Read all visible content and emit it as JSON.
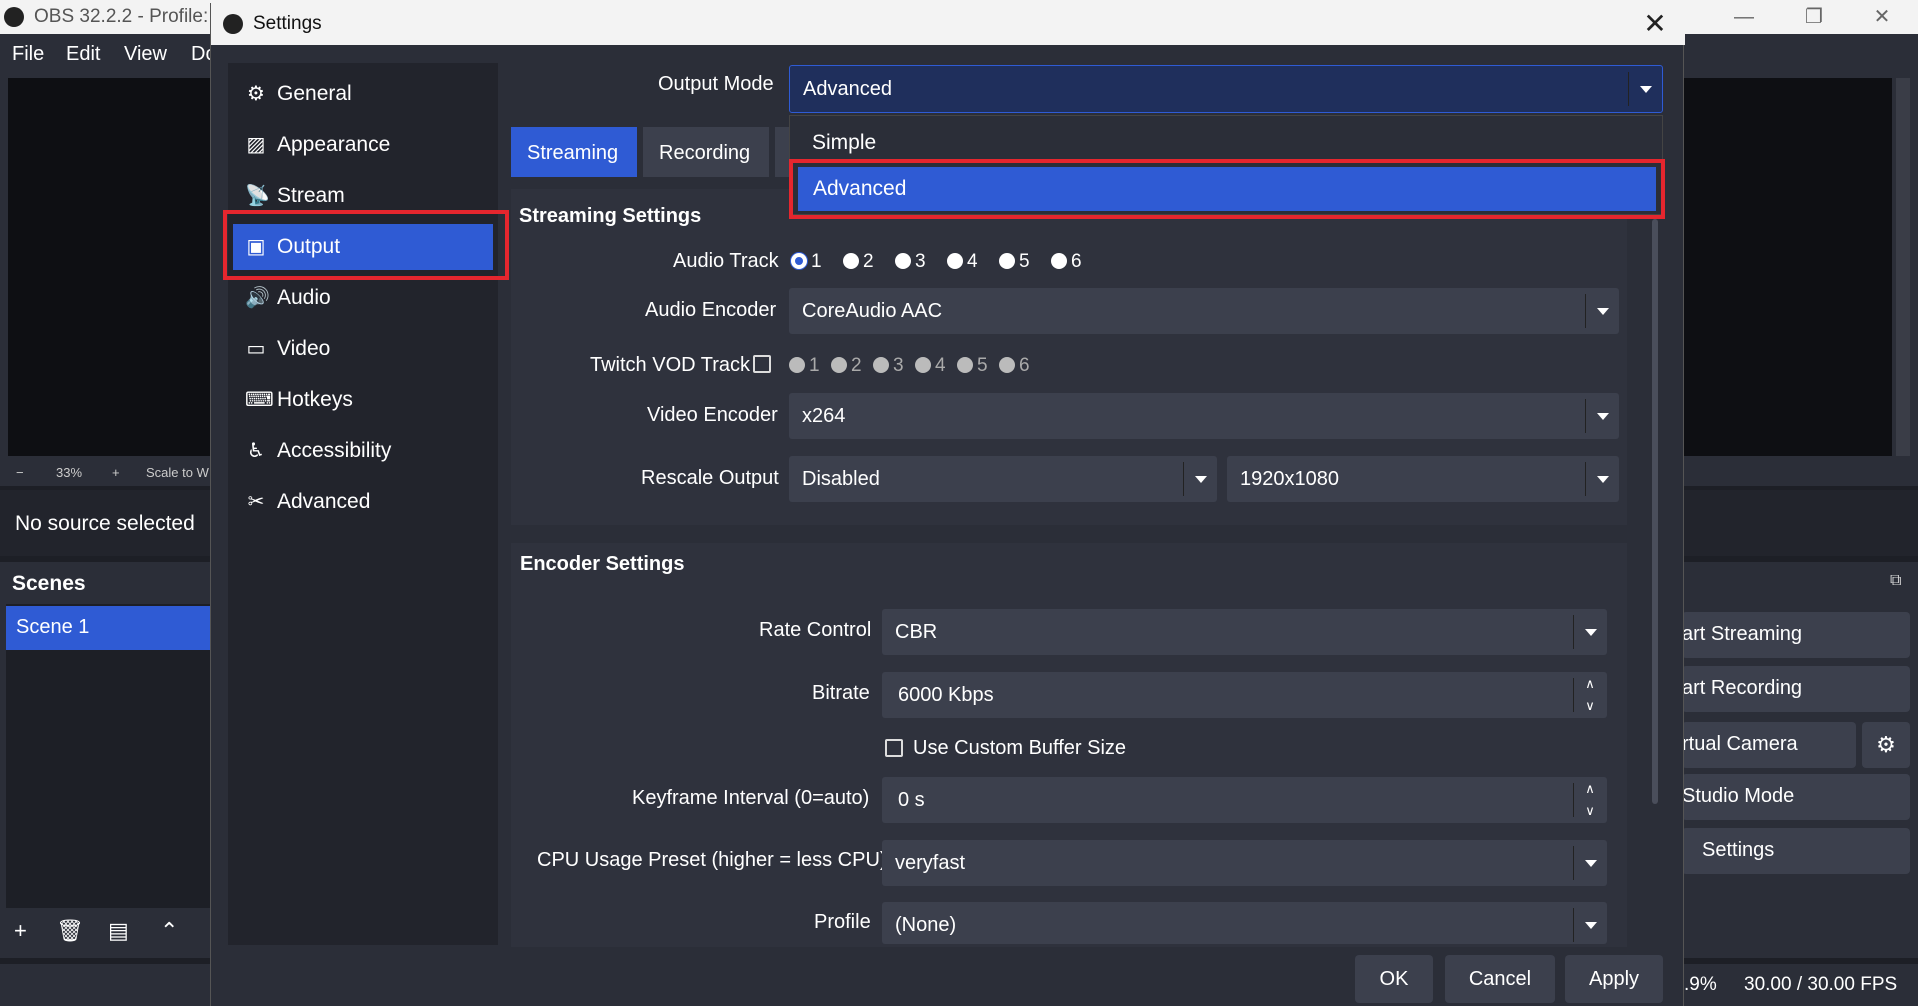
{
  "main": {
    "title": "OBS 32.2.2 - Profile: U",
    "menu": [
      "File",
      "Edit",
      "View",
      "Do"
    ],
    "zoom": {
      "minus": "−",
      "level": "33%",
      "plus": "+",
      "scale": "Scale to W"
    },
    "no_source": "No source selected",
    "scenes_title": "Scenes",
    "scene_item": "Scene 1",
    "controls": {
      "start_streaming": "art Streaming",
      "start_recording": "art Recording",
      "virtual_camera": "rtual Camera",
      "studio_mode": "Studio Mode",
      "settings": "Settings"
    },
    "status": {
      "cpu": ".9%",
      "fps": "30.00 / 30.00 FPS"
    }
  },
  "dialog": {
    "title": "Settings",
    "nav": [
      "General",
      "Appearance",
      "Stream",
      "Output",
      "Audio",
      "Video",
      "Hotkeys",
      "Accessibility",
      "Advanced"
    ],
    "output_mode_label": "Output Mode",
    "output_mode_value": "Advanced",
    "output_mode_options": [
      "Simple",
      "Advanced"
    ],
    "tabs": [
      "Streaming",
      "Recording"
    ],
    "streaming": {
      "title": "Streaming Settings",
      "audio_track_label": "Audio Track",
      "audio_tracks": [
        "1",
        "2",
        "3",
        "4",
        "5",
        "6"
      ],
      "audio_encoder_label": "Audio Encoder",
      "audio_encoder_value": "CoreAudio AAC",
      "twitch_label": "Twitch VOD Track",
      "twitch_tracks": [
        "1",
        "2",
        "3",
        "4",
        "5",
        "6"
      ],
      "video_encoder_label": "Video Encoder",
      "video_encoder_value": "x264",
      "rescale_label": "Rescale Output",
      "rescale_value": "Disabled",
      "rescale_res": "1920x1080"
    },
    "encoder": {
      "title": "Encoder Settings",
      "rate_control_label": "Rate Control",
      "rate_control_value": "CBR",
      "bitrate_label": "Bitrate",
      "bitrate_value": "6000 Kbps",
      "custom_buffer_label": "Use Custom Buffer Size",
      "keyframe_label": "Keyframe Interval (0=auto)",
      "keyframe_value": "0 s",
      "cpu_preset_label": "CPU Usage Preset (higher = less CPU)",
      "cpu_preset_value": "veryfast",
      "profile_label": "Profile",
      "profile_value": "(None)"
    },
    "buttons": {
      "ok": "OK",
      "cancel": "Cancel",
      "apply": "Apply"
    }
  },
  "colors": {
    "accent": "#2f5bd4",
    "highlight": "#e5262e",
    "panel": "#2b2e38"
  }
}
